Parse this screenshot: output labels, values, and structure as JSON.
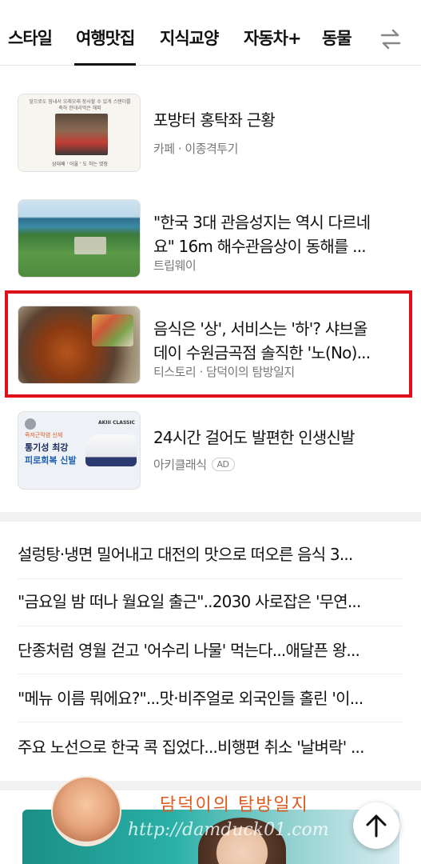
{
  "tabs": [
    {
      "label": "스타일",
      "active": false
    },
    {
      "label": "여행맛집",
      "active": true
    },
    {
      "label": "지식교양",
      "active": false
    },
    {
      "label": "자동차+",
      "active": false
    },
    {
      "label": "동물",
      "active": false
    }
  ],
  "swap_icon": "swap-arrows-icon",
  "cards": [
    {
      "title_lines": [
        "포방터 홍탁좌 근황"
      ],
      "source": "카페 · 이종격투기",
      "thumb": "restaurant-owners-photo"
    },
    {
      "title_lines": [
        "\"한국 3대 관음성지는 역시 다르네",
        "요\" 16m 해수관음상이 동해를 ..."
      ],
      "source": "트립웨이",
      "thumb": "coastal-aerial-photo"
    },
    {
      "title_lines": [
        "음식은 '상', 서비스는 '하'? 샤브올",
        "데이 수원금곡점 솔직한 '노(No)..."
      ],
      "source": "티스토리 · 담덕이의 탐방일지",
      "thumb": "shabu-shabu-photo"
    },
    {
      "title_lines": [
        "24시간 걸어도 발편한 인생신발"
      ],
      "source": "아키클래식",
      "ad_badge": "AD",
      "thumb": "sneaker-ad-image",
      "thumb_texts": {
        "small": "족저근막염 신체",
        "line1": "통기성 최강",
        "line2": "피로회복 신발",
        "brand": "AKIII CLASSIC"
      }
    }
  ],
  "thumb1_caption": "삼대째 ' 어울 ' 도 하는 엿장",
  "thumb1_top": "앞으로도 힘내서 오래오래 장사할 수 있게 스탠더를 축하 한데리먹은 해피",
  "headlines": [
    "설렁탕·냉면 밀어내고 대전의 맛으로 떠오른 음식 3...",
    "\"금요일 밤 떠나 월요일 출근\"..2030 사로잡은 '무연...",
    "단종처럼 영월 걷고 '어수리 나물' 먹는다...애달픈 왕...",
    "\"메뉴 이름 뭐에요?\"...맛·비주얼로 외국인들 홀린 '이...",
    "주요 노선으로 한국 콕 집었다...비행편 취소 '날벼락' ..."
  ],
  "blog_banner": {
    "name": "담덕이의 탐방일지",
    "url": "http://damduck01.com"
  },
  "colors": {
    "highlight": "#e0101a",
    "accent_text": "#e05a1e"
  }
}
